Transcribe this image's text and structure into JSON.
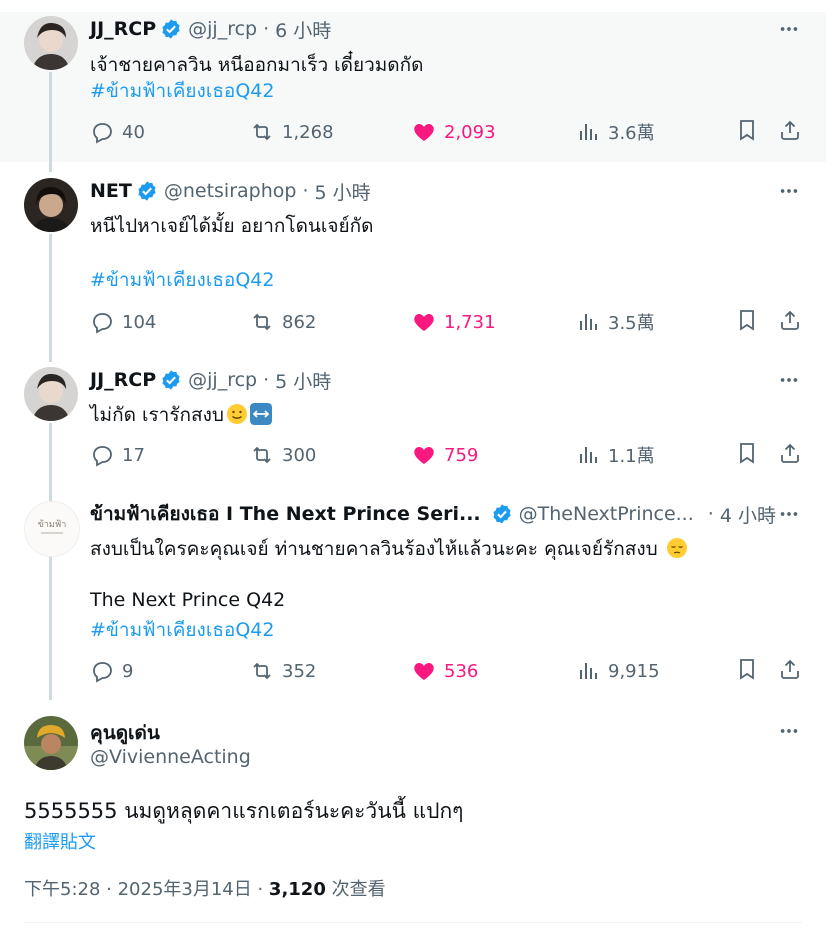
{
  "replies": [
    {
      "name": "JJ_RCP",
      "handle": "@jj_rcp",
      "time": "6 小時",
      "text": "เจ้าชายคาลวิน หนีออกมาเร็ว เดี๋ยวมดกัด",
      "hashtag": "#ข้ามฟ้าเคียงเธอQ42",
      "replies": "40",
      "reposts": "1,268",
      "likes": "2,093",
      "views": "3.6萬"
    },
    {
      "name": "NET",
      "handle": "@netsiraphop",
      "time": "5 小時",
      "text": "หนีไปหาเจย์ได้มั้ย อยากโดนเจย์กัด",
      "hashtag": "#ข้ามฟ้าเคียงเธอQ42",
      "replies": "104",
      "reposts": "862",
      "likes": "1,731",
      "views": "3.5萬"
    },
    {
      "name": "JJ_RCP",
      "handle": "@jj_rcp",
      "time": "5 小時",
      "text": "ไม่กัด เรารักสงบ",
      "replies": "17",
      "reposts": "300",
      "likes": "759",
      "views": "1.1萬"
    },
    {
      "name": "ข้ามฟ้าเคียงเธอ I The Next Prince Seri...",
      "handle": "@TheNextPrince...",
      "time": "4 小時",
      "avatar_text": "ข้ามฟ้า",
      "text": "สงบเป็นใครคะคุณเจย์ ท่านชายคาลวินร้องไห้แล้วนะคะ คุณเจย์รักสงบ",
      "line2": "The Next Prince Q42",
      "hashtag": "#ข้ามฟ้าเคียงเธอQ42",
      "replies": "9",
      "reposts": "352",
      "likes": "536",
      "views": "9,915"
    }
  ],
  "main": {
    "name": "คุนดูเด่น",
    "handle": "@VivienneActing",
    "text": "5555555 นมดูหลุดคาแรกเตอร์นะคะวันนี้ แปกๆ",
    "translate": "翻譯貼文",
    "time": "下午5:28 · 2025年3月14日 · ",
    "views_count": "3,120",
    "views_label": " 次查看"
  },
  "icons": {
    "verified": "verified-badge-icon",
    "more": "more-icon",
    "reply": "reply-icon",
    "repost": "repost-icon",
    "like": "heart-icon",
    "views": "views-icon",
    "bookmark": "bookmark-icon",
    "share": "share-icon"
  },
  "colors": {
    "accent": "#1d9bf0",
    "like": "#f91880",
    "muted": "#536471",
    "highlight_bg": "#f7f9f9"
  }
}
